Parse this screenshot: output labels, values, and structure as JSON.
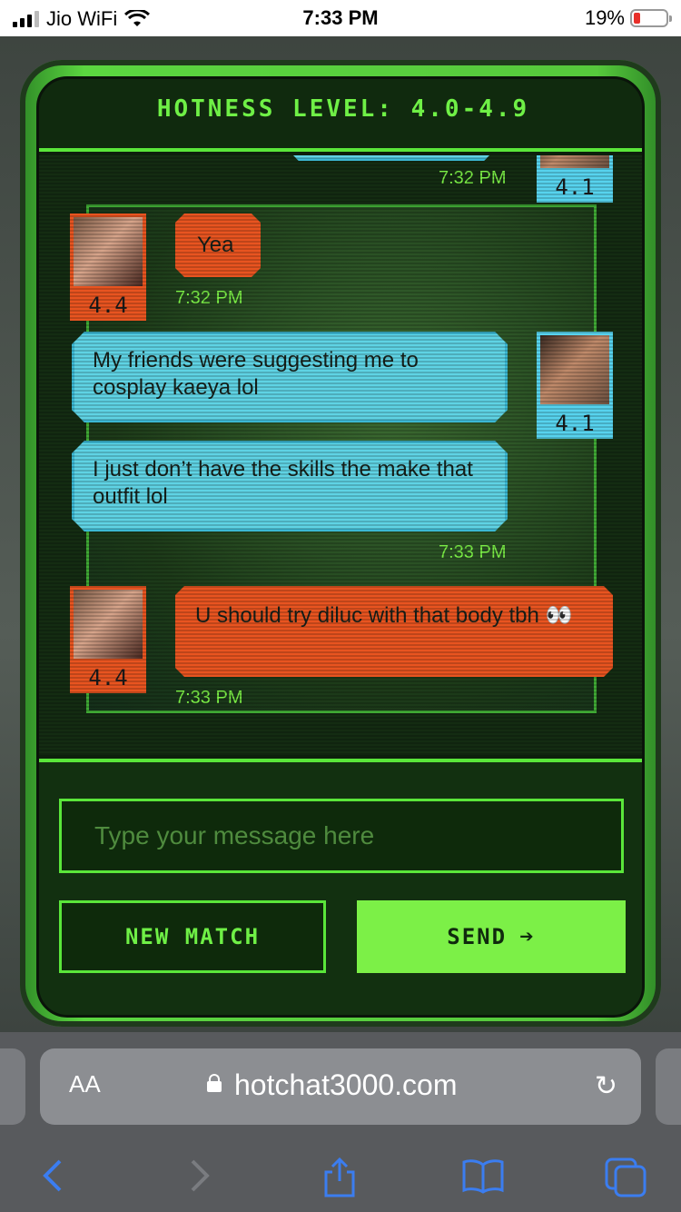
{
  "status_bar": {
    "carrier": "Jio WiFi",
    "time": "7:33 PM",
    "battery": "19%"
  },
  "app": {
    "title": "HOTNESS LEVEL: 4.0-4.9",
    "input_placeholder": "Type your message here",
    "new_match_label": "NEW MATCH",
    "send_label": "SEND"
  },
  "messages": [
    {
      "side": "right",
      "text": "",
      "time": "7:32 PM",
      "score": "4.1"
    },
    {
      "side": "left",
      "text": "Yea",
      "time": "7:32 PM",
      "score": "4.4"
    },
    {
      "side": "right",
      "text": "My friends were suggesting me to cosplay kaeya lol",
      "score": "4.1"
    },
    {
      "side": "right",
      "text": "I just don’t have the skills the make that outfit lol",
      "time": "7:33 PM"
    },
    {
      "side": "left",
      "text": "U should try diluc with that body tbh 👀",
      "time": "7:33 PM",
      "score": "4.4"
    }
  ],
  "browser": {
    "text_size": "AA",
    "domain": "hotchat3000.com"
  },
  "colors": {
    "accent_green": "#5ae63a",
    "orange": "#e85420",
    "cyan": "#5fd3e4"
  },
  "icons": {
    "back": "chevron-left-icon",
    "forward": "chevron-right-icon",
    "share": "share-icon",
    "bookmarks": "book-icon",
    "tabs": "tabs-icon"
  }
}
